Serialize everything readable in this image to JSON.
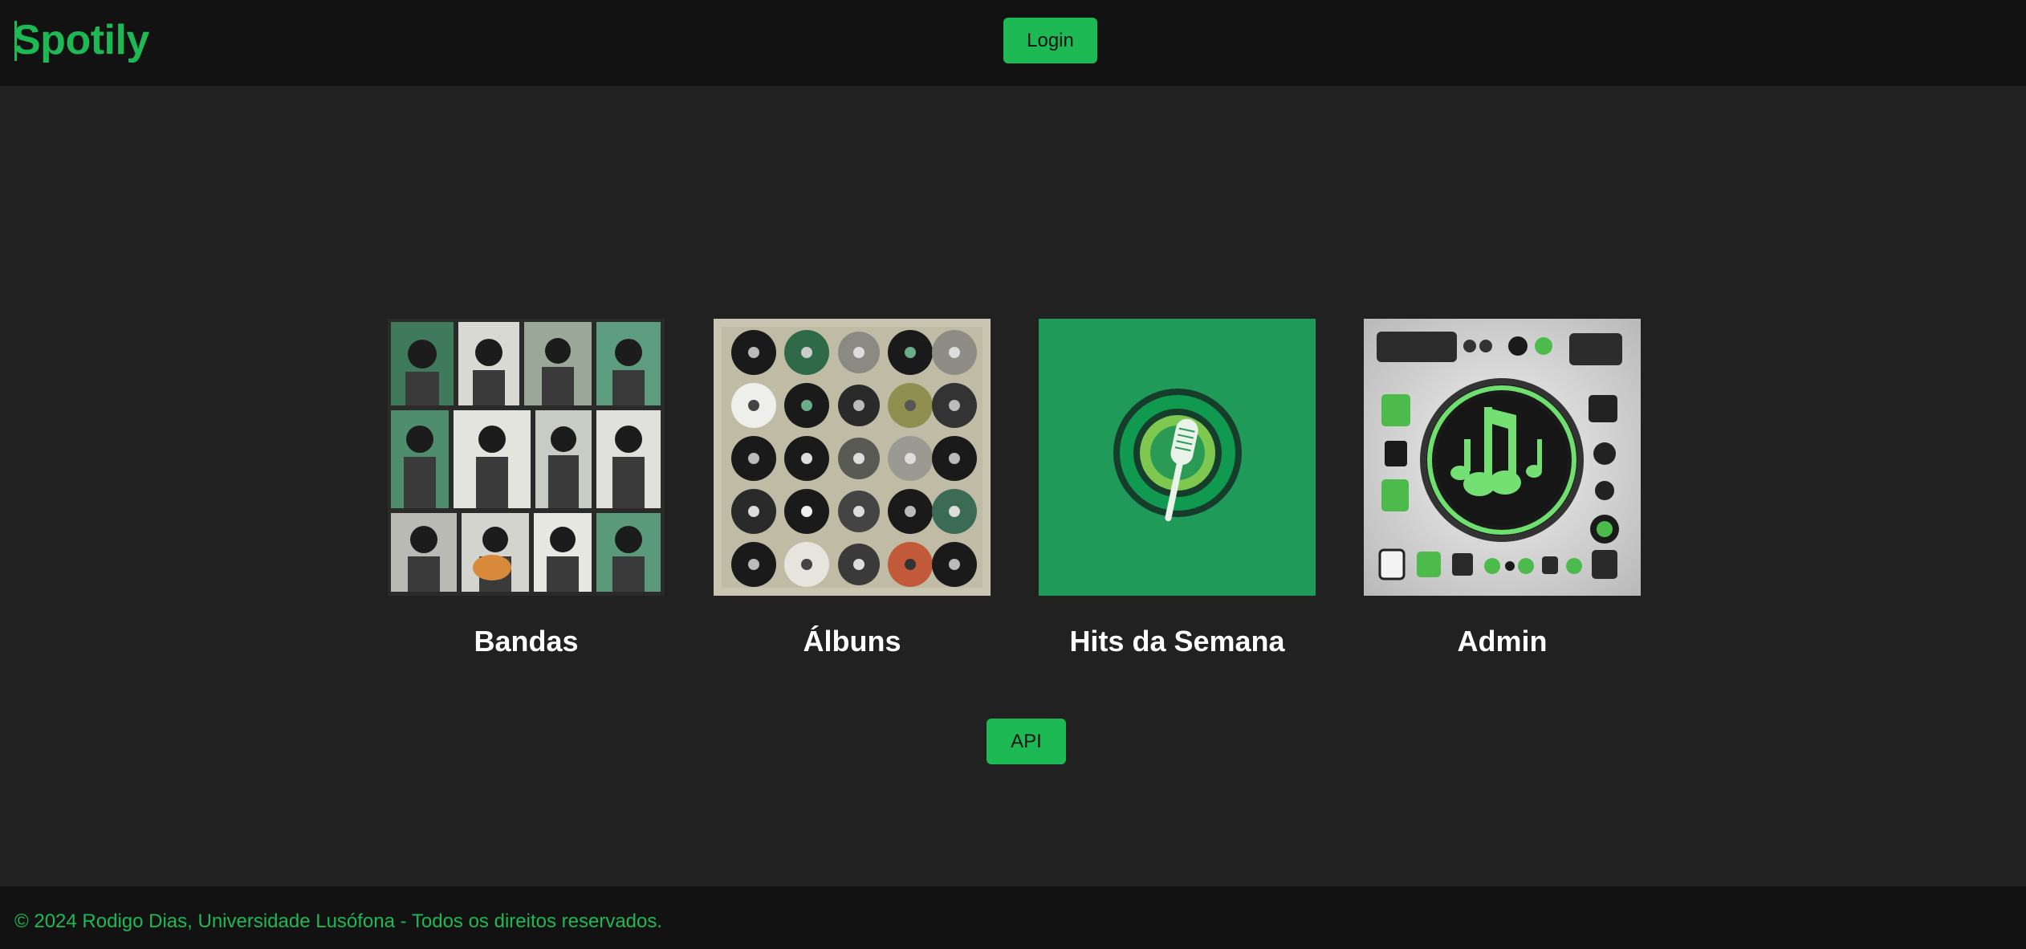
{
  "header": {
    "brand": "Spotily",
    "login_label": "Login"
  },
  "cards": [
    {
      "label": "Bandas",
      "image": "bands-illustration"
    },
    {
      "label": "Álbuns",
      "image": "vinyl-records-grid"
    },
    {
      "label": "Hits da Semana",
      "image": "microphone-logo"
    },
    {
      "label": "Admin",
      "image": "music-note-control-panel"
    }
  ],
  "api_label": "API",
  "footer": {
    "text": "© 2024 Rodigo Dias, Universidade Lusófona - Todos os direitos reservados."
  },
  "colors": {
    "accent": "#1db954",
    "header_bg": "#121212",
    "page_bg": "#212121"
  }
}
